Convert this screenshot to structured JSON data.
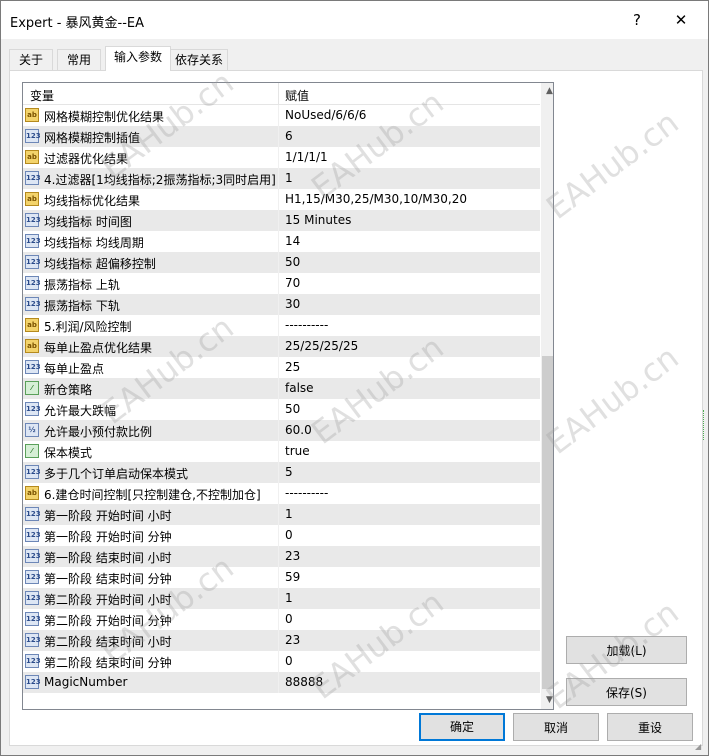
{
  "window": {
    "title": "Expert - 暴风黄金--EA",
    "help_glyph": "?",
    "close_glyph": "✕"
  },
  "tabs": [
    {
      "label": "关于"
    },
    {
      "label": "常用"
    },
    {
      "label": "输入参数"
    },
    {
      "label": "依存关系"
    }
  ],
  "grid": {
    "header": {
      "col_variable": "变量",
      "col_value": "赋值"
    },
    "rows": [
      {
        "icon": "ab",
        "name": "网格模糊控制优化结果",
        "value": "NoUsed/6/6/6"
      },
      {
        "icon": "123",
        "name": "网格模糊控制插值",
        "value": "6"
      },
      {
        "icon": "ab",
        "name": "过滤器优化结果",
        "value": "1/1/1/1"
      },
      {
        "icon": "123",
        "name": "4.过滤器[1均线指标;2振荡指标;3同时启用]",
        "value": "1"
      },
      {
        "icon": "ab",
        "name": "均线指标优化结果",
        "value": "H1,15/M30,25/M30,10/M30,20"
      },
      {
        "icon": "123",
        "name": "均线指标 时间图",
        "value": "15 Minutes"
      },
      {
        "icon": "123",
        "name": "均线指标 均线周期",
        "value": "14"
      },
      {
        "icon": "123",
        "name": "均线指标 超偏移控制",
        "value": "50"
      },
      {
        "icon": "123",
        "name": "振荡指标 上轨",
        "value": "70"
      },
      {
        "icon": "123",
        "name": "振荡指标 下轨",
        "value": "30"
      },
      {
        "icon": "ab",
        "name": "5.利润/风险控制",
        "value": "----------"
      },
      {
        "icon": "ab",
        "name": "每单止盈点优化结果",
        "value": "25/25/25/25"
      },
      {
        "icon": "123",
        "name": "每单止盈点",
        "value": "25"
      },
      {
        "icon": "bool",
        "name": "新仓策略",
        "value": "false"
      },
      {
        "icon": "123",
        "name": "允许最大跌幅",
        "value": "50"
      },
      {
        "icon": "half",
        "name": "允许最小预付款比例",
        "value": "60.0"
      },
      {
        "icon": "bool",
        "name": "保本模式",
        "value": "true"
      },
      {
        "icon": "123",
        "name": "多于几个订单启动保本模式",
        "value": "5"
      },
      {
        "icon": "ab",
        "name": "6.建仓时间控制[只控制建仓,不控制加仓]",
        "value": "----------"
      },
      {
        "icon": "123",
        "name": "第一阶段 开始时间 小时",
        "value": "1"
      },
      {
        "icon": "123",
        "name": "第一阶段 开始时间 分钟",
        "value": "0"
      },
      {
        "icon": "123",
        "name": "第一阶段 结束时间 小时",
        "value": "23"
      },
      {
        "icon": "123",
        "name": "第一阶段 结束时间 分钟",
        "value": "59"
      },
      {
        "icon": "123",
        "name": "第二阶段 开始时间 小时",
        "value": "1"
      },
      {
        "icon": "123",
        "name": "第二阶段 开始时间 分钟",
        "value": "0"
      },
      {
        "icon": "123",
        "name": "第二阶段 结束时间 小时",
        "value": "23"
      },
      {
        "icon": "123",
        "name": "第二阶段 结束时间 分钟",
        "value": "0"
      },
      {
        "icon": "123",
        "name": "MagicNumber",
        "value": "88888"
      }
    ]
  },
  "buttons": {
    "load": "加载(L)",
    "save": "保存(S)",
    "ok": "确定",
    "cancel": "取消",
    "reset": "重设"
  },
  "watermark": "EAHub.cn",
  "colors": {
    "ok_button_border": "#0078d7",
    "alt_row": "#e9e9e9"
  }
}
